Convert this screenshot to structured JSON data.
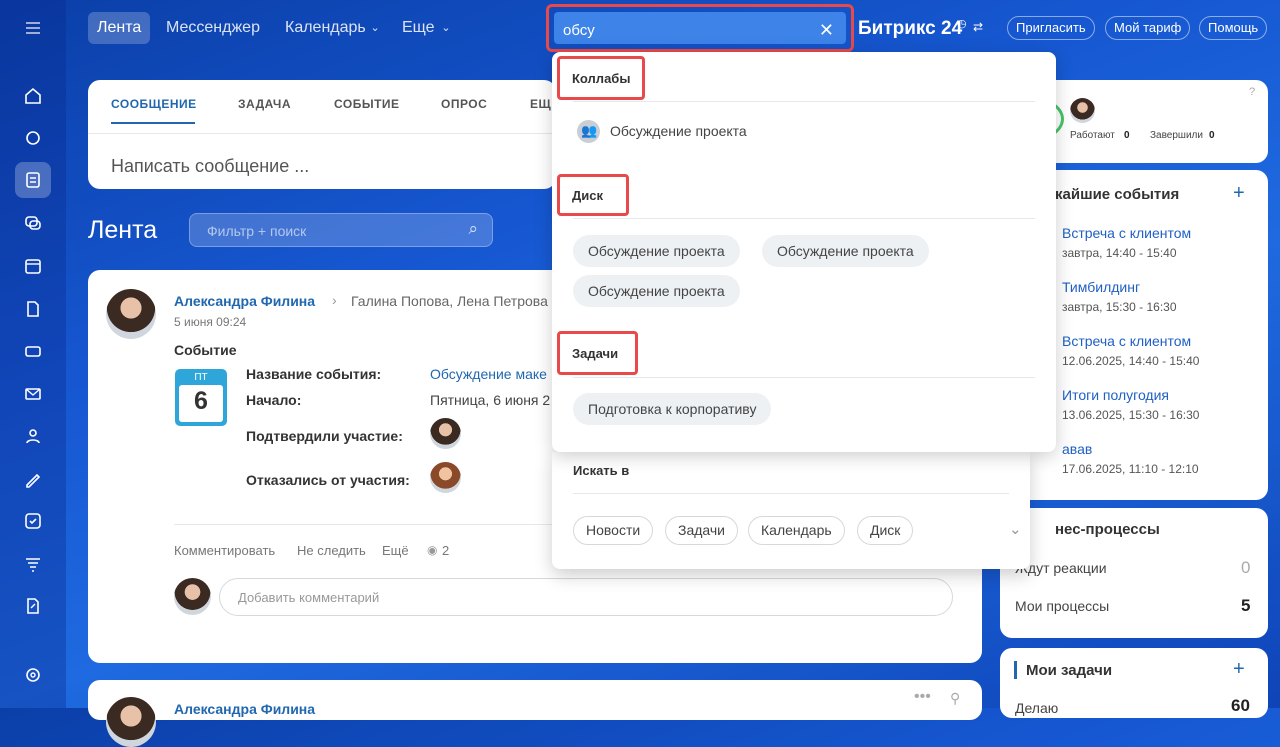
{
  "nav": {
    "menu_icon": "hamburger-icon",
    "items": [
      {
        "label": "Лента"
      },
      {
        "label": "Мессенджер"
      },
      {
        "label": "Календарь"
      },
      {
        "label": "Еще"
      }
    ]
  },
  "header": {
    "brand": "Битрикс 24",
    "invite": "Пригласить",
    "tariff": "Мой тариф",
    "help": "Помощь"
  },
  "search": {
    "value": "обсу"
  },
  "composer": {
    "tabs": [
      "СООБЩЕНИЕ",
      "ЗАДАЧА",
      "СОБЫТИЕ",
      "ОПРОС",
      "ЕЩ"
    ],
    "placeholder": "Написать сообщение ..."
  },
  "feed": {
    "title": "Лента",
    "filter_placeholder": "Фильтр + поиск"
  },
  "post": {
    "author": "Александра Филина",
    "recipients": "Галина Попова, Лена Петрова",
    "date": "5 июня 09:24",
    "type": "Событие",
    "cal_day": "ПТ",
    "cal_num": "6",
    "name_label": "Название события:",
    "name_value": "Обсуждение маке",
    "start_label": "Начало:",
    "start_value": "Пятница, 6 июня 2",
    "confirmed_label": "Подтвердили участие:",
    "declined_label": "Отказались от участия:",
    "actions": [
      "Комментировать",
      "Не следить",
      "Ещё"
    ],
    "views": "2",
    "comment_placeholder": "Добавить комментарий"
  },
  "post2": {
    "author": "Александра Филина"
  },
  "dropdown": {
    "sections": [
      {
        "title": "Коллабы"
      },
      {
        "title": "Диск"
      },
      {
        "title": "Задачи"
      }
    ],
    "collab_item": "Обсуждение проекта",
    "disk_items": [
      "Обсуждение проекта",
      "Обсуждение проекта",
      "Обсуждение проекта"
    ],
    "task_items": [
      "Подготовка к корпоративу"
    ],
    "search_in_title": "Искать в",
    "search_in_items": [
      "Новости",
      "Задачи",
      "Календарь",
      "Диск"
    ]
  },
  "worktime": {
    "working_label": "Работают",
    "working_count": "0",
    "finished_label": "Завершили",
    "finished_count": "0"
  },
  "events": {
    "title": "кайшие события",
    "items": [
      {
        "title": "Встреча с клиентом",
        "time": "завтра, 14:40 - 15:40"
      },
      {
        "title": "Тимбилдинг",
        "time": "завтра, 15:30 - 16:30"
      },
      {
        "title": "Встреча с клиентом",
        "time": "12.06.2025, 14:40 - 15:40"
      },
      {
        "title": "Итоги полугодия",
        "time": "13.06.2025, 15:30 - 16:30"
      },
      {
        "title": "авав",
        "time": "17.06.2025, 11:10 - 12:10"
      }
    ]
  },
  "processes": {
    "title": "нес-процессы",
    "waiting_label": "Ждут реакции",
    "waiting_count": "0",
    "mine_label": "Мои процессы",
    "mine_count": "5"
  },
  "tasks": {
    "title": "Мои задачи",
    "first_label": "Делаю",
    "first_count": "60"
  },
  "colors": {
    "accent": "#2067b0",
    "highlight": "#e8494a",
    "link": "#1f60c4"
  }
}
